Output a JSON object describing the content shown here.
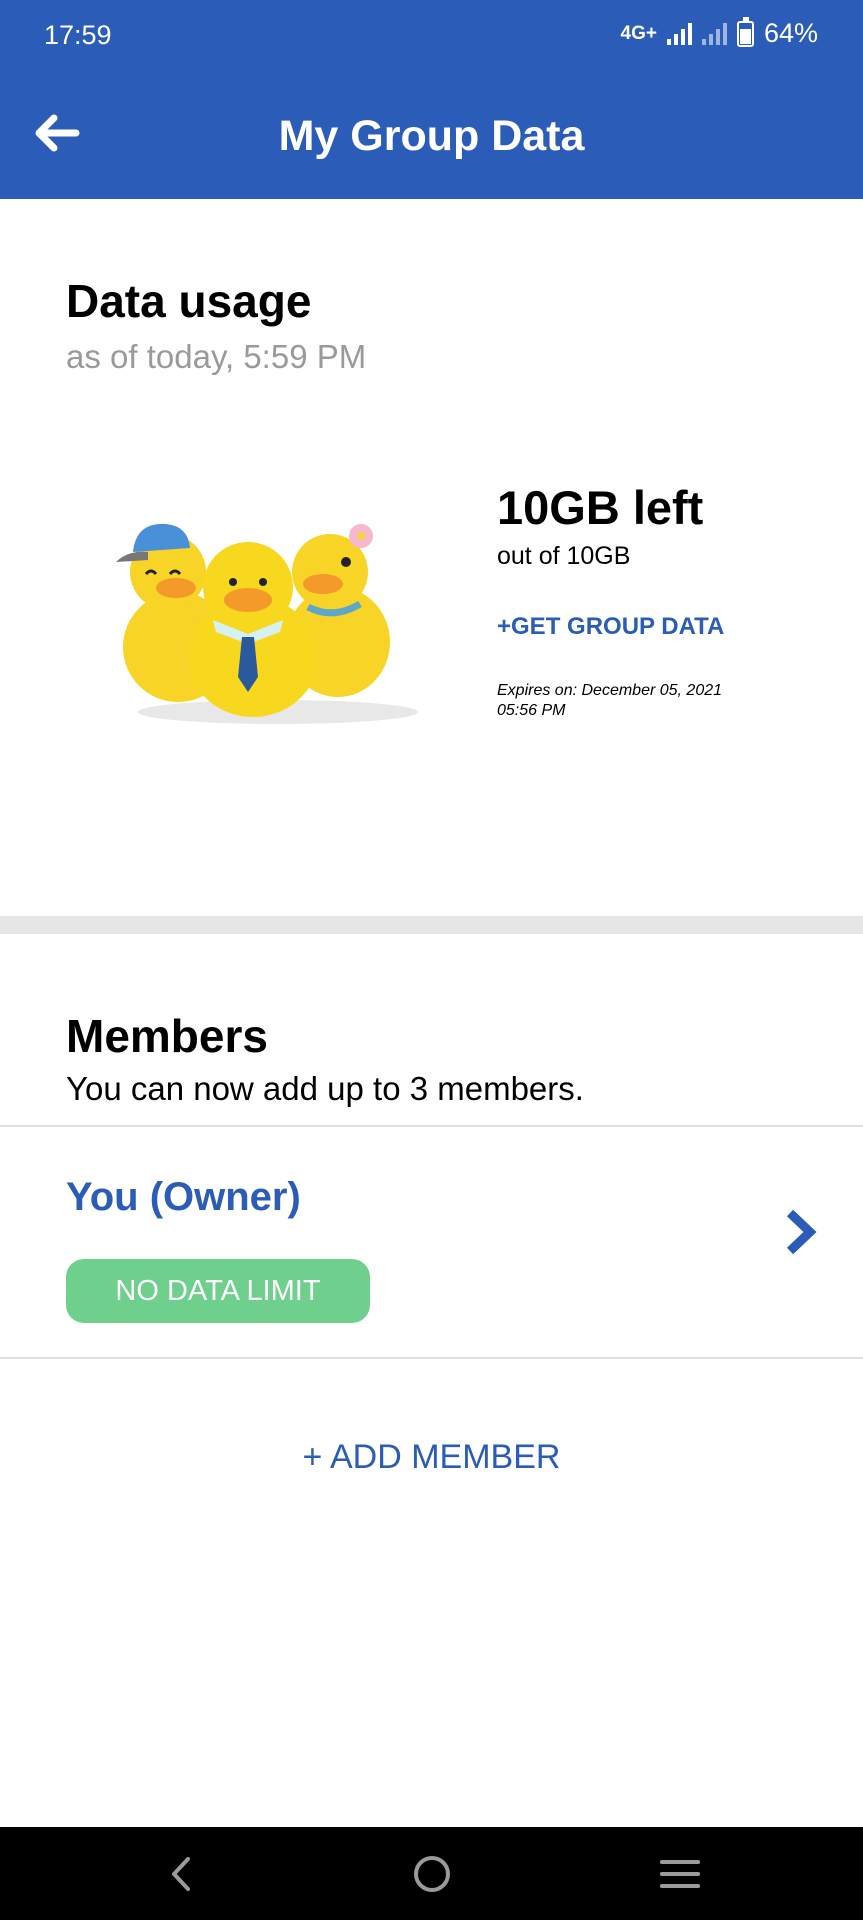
{
  "status_bar": {
    "time": "17:59",
    "network": "4G+",
    "battery": "64%",
    "battery_level_fraction": 0.64
  },
  "header": {
    "title": "My Group Data",
    "back_icon": "arrow-left-icon",
    "background_color": "#2b5cb8"
  },
  "usage": {
    "title": "Data usage",
    "subtitle": "as of today, 5:59 PM",
    "illustration": "ducks-illustration",
    "remaining": "10GB left",
    "total": "out of 10GB",
    "get_data_label": "+GET GROUP DATA",
    "expires_line1": "Expires on: December 05, 2021",
    "expires_line2": "05:56 PM"
  },
  "members": {
    "title": "Members",
    "subtitle": "You can now add up to 3 members.",
    "items": [
      {
        "name": "You (Owner)",
        "limit": "NO DATA LIMIT",
        "chevron_icon": "chevron-right-icon"
      }
    ],
    "add_label": "+ ADD MEMBER"
  },
  "nav_bar": {
    "back_icon": "nav-back-icon",
    "home_icon": "nav-home-icon",
    "menu_icon": "nav-menu-icon"
  },
  "colors": {
    "accent": "#2b5cb8",
    "badge_green": "#6fd08d",
    "muted_text": "#9a9a9a"
  }
}
